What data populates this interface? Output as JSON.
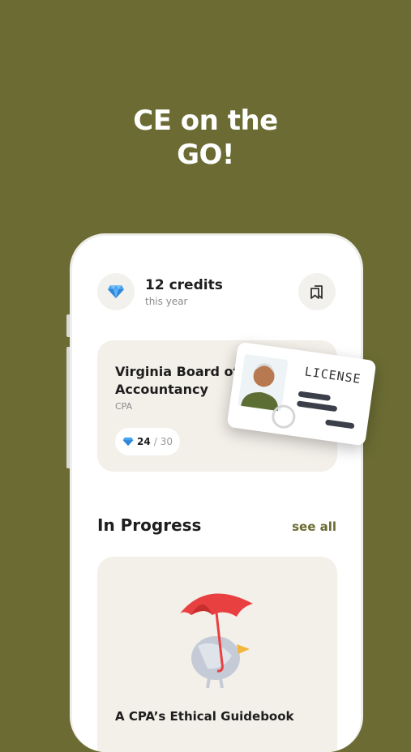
{
  "headline": {
    "line1": "CE on the",
    "line2": "GO!"
  },
  "header": {
    "credits": "12 credits",
    "period": "this year",
    "credits_icon": "diamond-icon",
    "action_icon": "bookmarks-icon"
  },
  "board": {
    "name": "Virginia Board of Accountancy",
    "type": "CPA",
    "progress_current": "24",
    "progress_separator": "/",
    "progress_total": "30",
    "license_label": "LICENSE"
  },
  "in_progress": {
    "title": "In Progress",
    "see_all": "see all"
  },
  "course": {
    "title": "A CPA’s Ethical Guidebook"
  },
  "colors": {
    "background": "#6b6b33",
    "card": "#f3efe9",
    "accent": "#6b6b33",
    "umbrella": "#e84040"
  }
}
